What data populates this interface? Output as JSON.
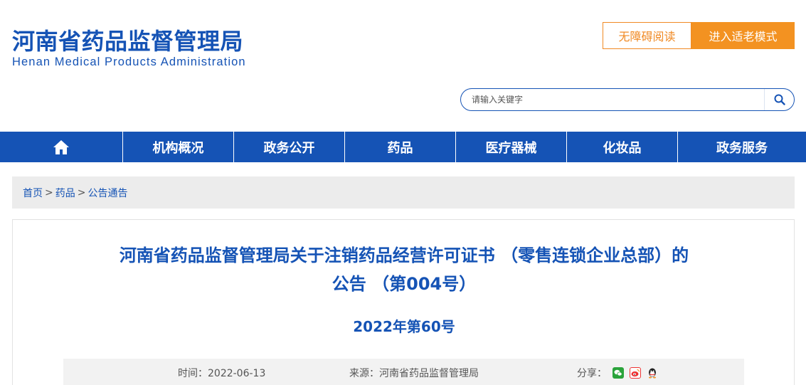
{
  "header": {
    "logo_cn": "河南省药品监督管理局",
    "logo_en": "Henan Medical Products Administration",
    "accessible_label": "无障碍阅读",
    "elder_mode_label": "进入适老模式"
  },
  "search": {
    "placeholder": "请输入关键字"
  },
  "nav": {
    "items": [
      "机构概况",
      "政务公开",
      "药品",
      "医疗器械",
      "化妆品",
      "政务服务"
    ]
  },
  "breadcrumb": {
    "home": "首页",
    "level1": "药品",
    "level2": "公告通告",
    "sep1": ">",
    "sep2": ">"
  },
  "article": {
    "title_line1": "河南省药品监督管理局关于注销药品经营许可证书 （零售连锁企业总部）的",
    "title_line2": "公告 （第004号）",
    "doc_no": "2022年第60号",
    "time": "时间：2022-06-13",
    "source": "来源：河南省药品监督管理局",
    "share_label": "分享："
  },
  "colors": {
    "brand_blue": "#1553b5",
    "accent_orange": "#f39221"
  }
}
